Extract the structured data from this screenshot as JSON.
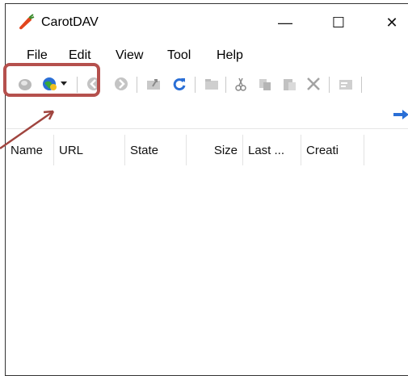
{
  "window": {
    "title": "CarotDAV",
    "minimize_glyph": "—",
    "maximize_glyph": "☐",
    "close_glyph": "✕"
  },
  "menu": {
    "items": [
      "File",
      "Edit",
      "View",
      "Tool",
      "Help"
    ]
  },
  "toolbar": {
    "buttons": [
      {
        "icon": "disconnect-icon"
      },
      {
        "icon": "connect-icon"
      },
      {
        "icon": "back-icon"
      },
      {
        "icon": "forward-icon"
      },
      {
        "icon": "up-folder-icon"
      },
      {
        "icon": "refresh-icon"
      },
      {
        "icon": "new-folder-icon"
      },
      {
        "icon": "cut-icon"
      },
      {
        "icon": "copy-icon"
      },
      {
        "icon": "paste-icon"
      },
      {
        "icon": "delete-icon"
      },
      {
        "icon": "properties-icon"
      }
    ]
  },
  "file_list": {
    "columns": [
      "Name",
      "URL",
      "State",
      "Size",
      "Last ...",
      "Creati"
    ]
  },
  "colors": {
    "highlight": "#b5504d",
    "accent_blue": "#2a6fd6"
  }
}
